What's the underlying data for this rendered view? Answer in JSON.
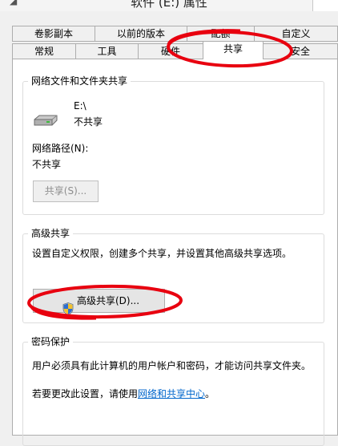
{
  "window": {
    "title": "软件 (E:) 属性"
  },
  "tabs": {
    "row1": [
      "卷影副本",
      "以前的版本",
      "配额",
      "自定义"
    ],
    "row2": [
      "常规",
      "工具",
      "硬件",
      "共享",
      "安全"
    ],
    "selected": "共享"
  },
  "network_share": {
    "legend": "网络文件和文件夹共享",
    "drive_path": "E:\\",
    "share_status": "不共享",
    "network_path_label": "网络路径(N):",
    "network_path_value": "不共享",
    "share_button": "共享(S)..."
  },
  "advanced_share": {
    "legend": "高级共享",
    "description": "设置自定义权限，创建多个共享，并设置其他高级共享选项。",
    "button": "高级共享(D)..."
  },
  "password_protection": {
    "legend": "密码保护",
    "description": "用户必须具有此计算机的用户帐户和密码，才能访问共享文件夹。",
    "change_prefix": "若要更改此设置，请使用",
    "link_text": "网络和共享中心",
    "change_suffix": "。"
  },
  "icons": [
    "window-system-icon",
    "drive-icon",
    "uac-shield-icon"
  ],
  "annotation_color": "#e8000f"
}
